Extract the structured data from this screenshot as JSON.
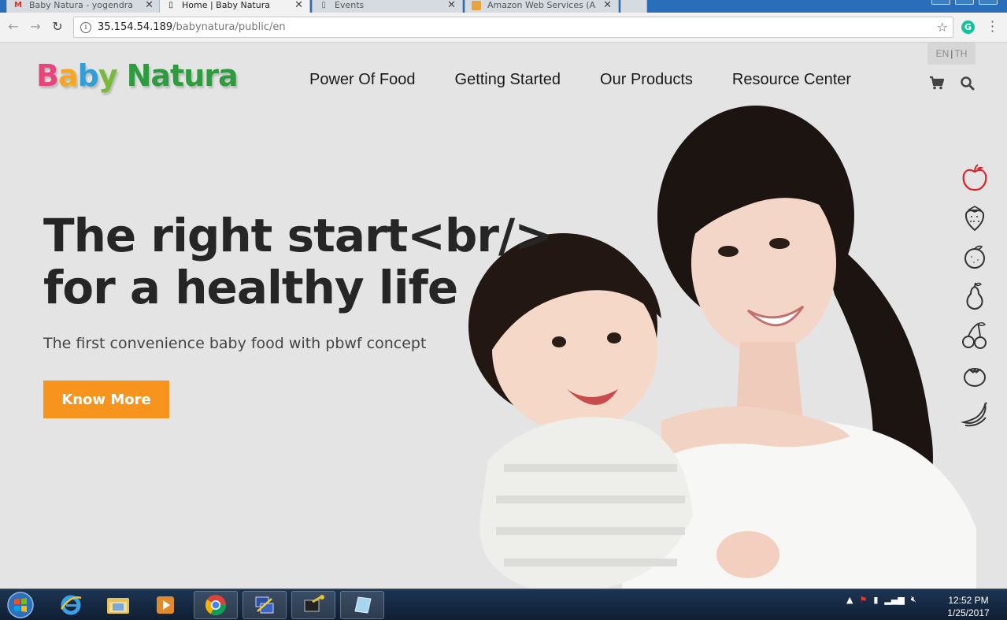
{
  "browser": {
    "tabs": [
      {
        "title": "Baby Natura - yogendra",
        "favicon": "gmail-icon",
        "active": false
      },
      {
        "title": "Home | Baby Natura",
        "favicon": "page-icon",
        "active": true
      },
      {
        "title": "Events",
        "favicon": "page-icon",
        "active": false
      },
      {
        "title": "Amazon Web Services (A",
        "favicon": "aws-icon",
        "active": false
      }
    ],
    "url_host": "35.154.54.189",
    "url_path": "/babynatura/public/en",
    "extension_label": "G"
  },
  "site": {
    "logo_word1": [
      "B",
      "a",
      "b",
      "y"
    ],
    "logo_word2": "Natura",
    "nav": [
      "Power Of Food",
      "Getting Started",
      "Our Products",
      "Resource Center"
    ],
    "lang_en": "EN",
    "lang_sep": "|",
    "lang_th": "TH"
  },
  "hero": {
    "title_line1": "The right start<br/>",
    "title_line2": "for a healthy life",
    "subtitle": "The first convenience baby food with pbwf concept",
    "cta_label": "Know More"
  },
  "fruit_icons": [
    "apple-icon",
    "strawberry-icon",
    "orange-icon",
    "pear-icon",
    "cherry-icon",
    "tomato-icon",
    "banana-icon"
  ],
  "colors": {
    "accent_orange": "#f7941d",
    "active_fruit": "#d9232d",
    "page_bg": "#e4e4e4"
  },
  "taskbar": {
    "time": "12:52 PM",
    "date": "1/25/2017"
  }
}
